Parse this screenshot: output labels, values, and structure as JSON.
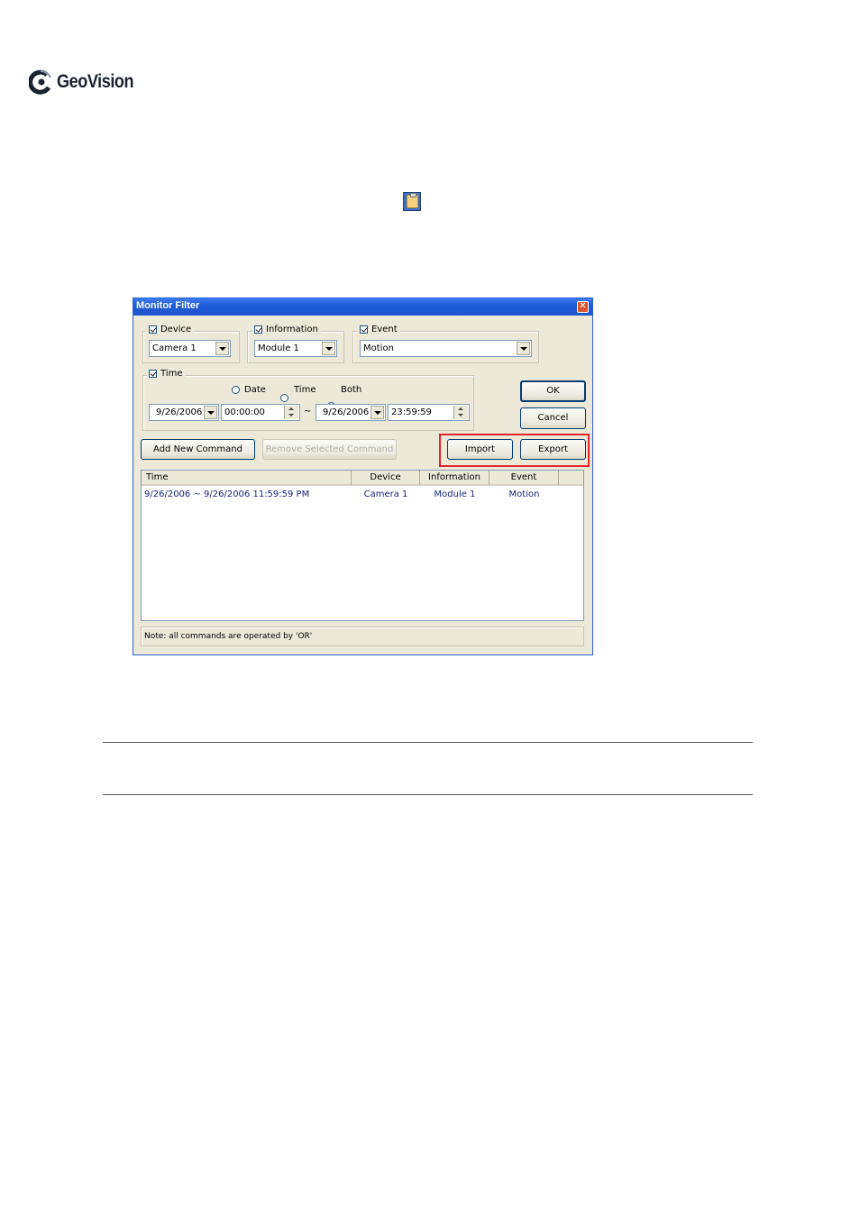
{
  "logo": {
    "brand": "GeoVision"
  },
  "dialog": {
    "title": "Monitor Filter",
    "close_glyph": "✕",
    "device": {
      "label": "Device",
      "checked": true,
      "selected": "Camera 1"
    },
    "information": {
      "label": "Information",
      "checked": true,
      "selected": "Module 1"
    },
    "event": {
      "label": "Event",
      "checked": true,
      "selected": "Motion"
    },
    "time": {
      "label": "Time",
      "checked": true,
      "radios": [
        {
          "label": "Date",
          "selected": false
        },
        {
          "label": "Time",
          "selected": false
        },
        {
          "label": "Both",
          "selected": true
        }
      ],
      "start_date": "9/26/2006",
      "start_time": "00:00:00",
      "separator": "~",
      "end_date": "9/26/2006",
      "end_time": "23:59:59"
    },
    "buttons": {
      "ok": "OK",
      "cancel": "Cancel",
      "add": "Add New Command",
      "remove": "Remove Selected Command",
      "import": "Import",
      "export": "Export"
    },
    "table": {
      "columns": [
        "Time",
        "Device",
        "Information",
        "Event"
      ],
      "rows": [
        {
          "time": "9/26/2006 ~ 9/26/2006 11:59:59 PM",
          "device": "Camera 1",
          "information": "Module 1",
          "event": "Motion"
        }
      ]
    },
    "status_note": "Note: all commands are operated by 'OR'"
  },
  "colors": {
    "highlight": "#e2242c",
    "titlebar": "#1f5bd8"
  }
}
